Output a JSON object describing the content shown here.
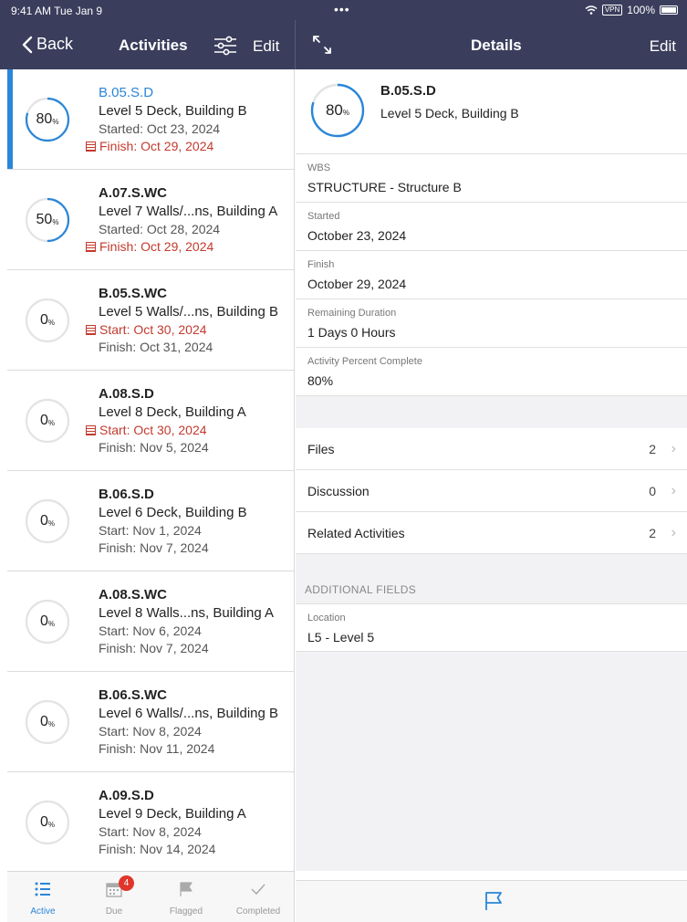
{
  "status": {
    "time": "9:41 AM  Tue Jan 9",
    "dots": "•••",
    "vpn": "VPN",
    "battery": "100%"
  },
  "nav_left": {
    "back_label": "Back",
    "title": "Activities",
    "edit_label": "Edit"
  },
  "nav_right": {
    "title": "Details",
    "edit_label": "Edit"
  },
  "activities": [
    {
      "id": "B.05.S.D",
      "name": "Level 5 Deck, Building B",
      "line3": "Started: Oct 23, 2024",
      "line4": "Finish: Oct 29, 2024",
      "pct": 80,
      "pct_label": "80",
      "unit": "%"
    },
    {
      "id": "A.07.S.WC",
      "name": "Level 7 Walls/...ns, Building A",
      "line3": "Started: Oct 28, 2024",
      "line4": "Finish: Oct 29, 2024",
      "pct": 50,
      "pct_label": "50",
      "unit": "%"
    },
    {
      "id": "B.05.S.WC",
      "name": "Level 5 Walls/...ns, Building B",
      "line3": "Start: Oct 30, 2024",
      "line4": "Finish: Oct 31, 2024",
      "pct": 0,
      "pct_label": "0",
      "unit": "%"
    },
    {
      "id": "A.08.S.D",
      "name": "Level 8 Deck, Building A",
      "line3": "Start: Oct 30, 2024",
      "line4": "Finish: Nov 5, 2024",
      "pct": 0,
      "pct_label": "0",
      "unit": "%"
    },
    {
      "id": "B.06.S.D",
      "name": "Level 6 Deck, Building B",
      "line3": "Start: Nov 1, 2024",
      "line4": "Finish: Nov 7, 2024",
      "pct": 0,
      "pct_label": "0",
      "unit": "%"
    },
    {
      "id": "A.08.S.WC",
      "name": "Level 8 Walls...ns, Building A",
      "line3": "Start: Nov 6, 2024",
      "line4": "Finish: Nov 7, 2024",
      "pct": 0,
      "pct_label": "0",
      "unit": "%"
    },
    {
      "id": "B.06.S.WC",
      "name": "Level 6 Walls/...ns, Building B",
      "line3": "Start: Nov 8, 2024",
      "line4": "Finish: Nov 11, 2024",
      "pct": 0,
      "pct_label": "0",
      "unit": "%"
    },
    {
      "id": "A.09.S.D",
      "name": "Level 9 Deck, Building A",
      "line3": "Start: Nov 8, 2024",
      "line4": "Finish: Nov 14, 2024",
      "pct": 0,
      "pct_label": "0",
      "unit": "%"
    }
  ],
  "tabs": [
    {
      "label": "Active",
      "icon": "list-icon"
    },
    {
      "label": "Due",
      "icon": "calendar-icon",
      "badge": "4"
    },
    {
      "label": "Flagged",
      "icon": "flag-icon"
    },
    {
      "label": "Completed",
      "icon": "checkmark-icon"
    }
  ],
  "details": {
    "id": "B.05.S.D",
    "name": "Level 5 Deck, Building B",
    "pct": 80,
    "pct_label": "80",
    "unit": "%",
    "fields": [
      {
        "label": "WBS",
        "value": "STRUCTURE - Structure B"
      },
      {
        "label": "Started",
        "value": "October 23, 2024"
      },
      {
        "label": "Finish",
        "value": "October 29, 2024"
      },
      {
        "label": "Remaining Duration",
        "value": "1 Days 0 Hours"
      },
      {
        "label": "Activity Percent Complete",
        "value": "80%"
      }
    ],
    "links": [
      {
        "label": "Files",
        "count": "2"
      },
      {
        "label": "Discussion",
        "count": "0"
      },
      {
        "label": "Related Activities",
        "count": "2"
      }
    ],
    "additional_title": "ADDITIONAL FIELDS",
    "additional": [
      {
        "label": "Location",
        "value": "L5 - Level 5"
      }
    ]
  },
  "colors": {
    "navbar": "#3a3e5c",
    "accent": "#2a86d8",
    "overdue": "#c23a2e",
    "badge": "#e0352b"
  }
}
